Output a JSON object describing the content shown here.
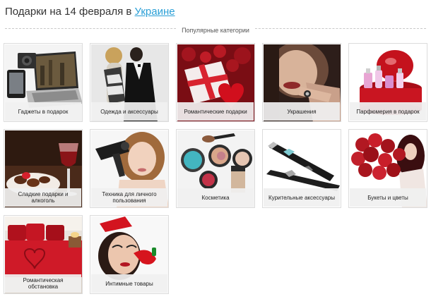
{
  "header": {
    "title_prefix": "Подарки на 14 февраля в ",
    "country_link": "Украине"
  },
  "section": {
    "label": "Популярные категории"
  },
  "colors": {
    "link": "#2a9fd6",
    "caption_bg": "#f0f0f0",
    "tile_border": "#dcdcdc",
    "accent_red": "#c8102e"
  },
  "categories": [
    {
      "label": "Гаджеты в подарок",
      "icon": "gadgets-photo"
    },
    {
      "label": "Одежда и аксессуары",
      "icon": "clothing-photo"
    },
    {
      "label": "Романтические подарки",
      "icon": "romantic-gift-photo"
    },
    {
      "label": "Украшения",
      "icon": "jewelry-photo"
    },
    {
      "label": "Парфюмерия в подарок",
      "icon": "perfume-photo"
    },
    {
      "label": "Сладкие подарки и алкоголь",
      "icon": "sweets-wine-photo"
    },
    {
      "label": "Техника для личного пользования",
      "icon": "personal-care-photo"
    },
    {
      "label": "Косметика",
      "icon": "cosmetics-photo"
    },
    {
      "label": "Курительные аксессуары",
      "icon": "e-cigarette-photo"
    },
    {
      "label": "Букеты и цветы",
      "icon": "bouquet-photo"
    },
    {
      "label": "Романтическая обстановка",
      "icon": "romantic-bedroom-photo"
    },
    {
      "label": "Интимные товары",
      "icon": "intimate-goods-photo"
    }
  ]
}
